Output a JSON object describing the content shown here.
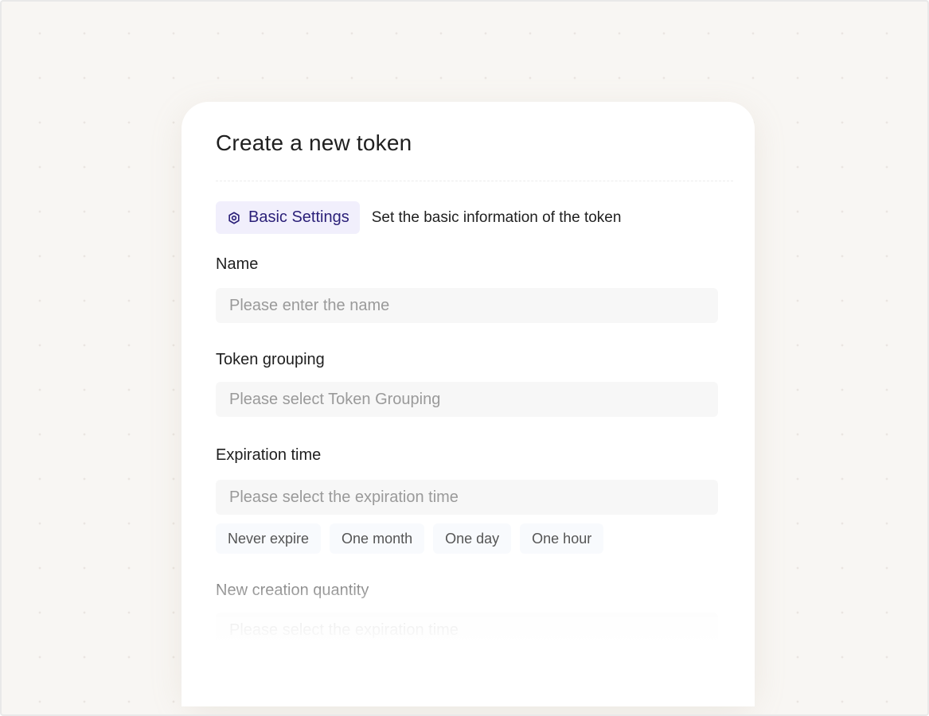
{
  "dialog": {
    "title": "Create a new token"
  },
  "section": {
    "icon": "settings-hexagon-icon",
    "tag_label": "Basic Settings",
    "description": "Set the basic information of the token",
    "accent_color": "#2a1f78",
    "tag_background": "#f1effc"
  },
  "fields": {
    "name": {
      "label": "Name",
      "placeholder": "Please enter the name"
    },
    "grouping": {
      "label": "Token grouping",
      "placeholder": "Please select Token Grouping"
    },
    "expiration": {
      "label": "Expiration time",
      "placeholder": "Please select the expiration time",
      "presets": [
        "Never expire",
        "One month",
        "One day",
        "One hour"
      ]
    },
    "quantity": {
      "label": "New creation quantity",
      "placeholder": "Please select the expiration time"
    }
  }
}
